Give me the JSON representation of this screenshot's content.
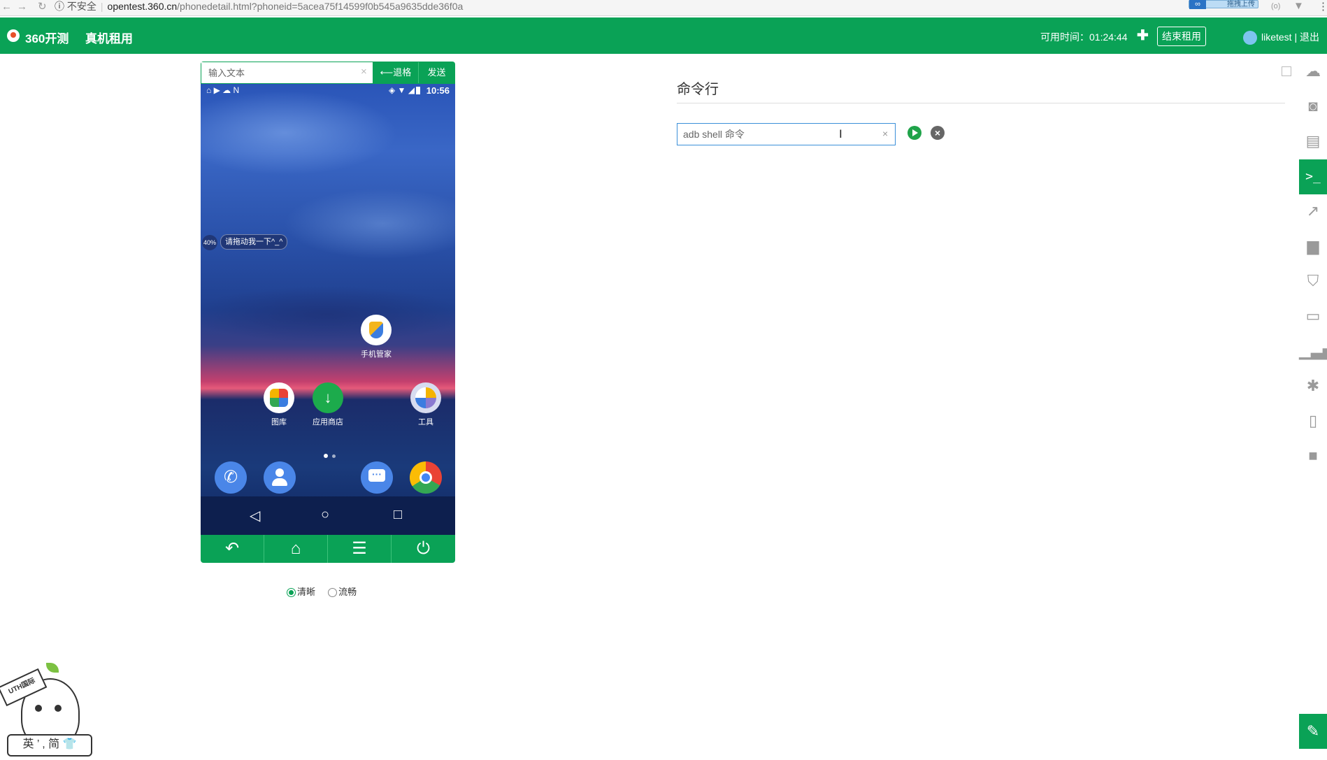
{
  "browser": {
    "nav_icons": [
      "back-icon",
      "forward-icon",
      "reload-icon"
    ],
    "security_label": "不安全",
    "url_host": "opentest.360.cn",
    "url_path": "/phonedetail.html?phoneid=5acea75f14599f0b545a9635dde36f0a",
    "extension_label": "拖拽上传"
  },
  "header": {
    "brand": "360开测",
    "nav_item": "真机租用",
    "available_time": "可用时间：01:24:44",
    "end_rent_label": "结束租用",
    "user_label": "liketest | 退出",
    "color": "#0aa256"
  },
  "phone": {
    "input_placeholder": "输入文本",
    "backspace_label": "⟵退格",
    "send_label": "发送",
    "status_time": "10:56",
    "float_percent": "40%",
    "float_hint": "请拖动我一下^_^",
    "apps": {
      "guard": "手机管家",
      "gallery": "图库",
      "store": "应用商店",
      "tools": "工具"
    },
    "quality_options": [
      "清晰",
      "流畅"
    ],
    "quality_selected": "清晰"
  },
  "command": {
    "title": "命令行",
    "placeholder": "adb shell 命令"
  },
  "sidebar_icons": [
    "upload-icon",
    "camera-icon",
    "document-icon",
    "terminal-icon",
    "chart-icon",
    "folder-icon",
    "html5-icon",
    "battery-icon",
    "signal-icon",
    "bug-icon",
    "mobile-icon",
    "video-icon",
    "edit-icon"
  ],
  "mascot": {
    "sign_text": "UTH国际",
    "bar_text": "英 ’ , 简"
  }
}
